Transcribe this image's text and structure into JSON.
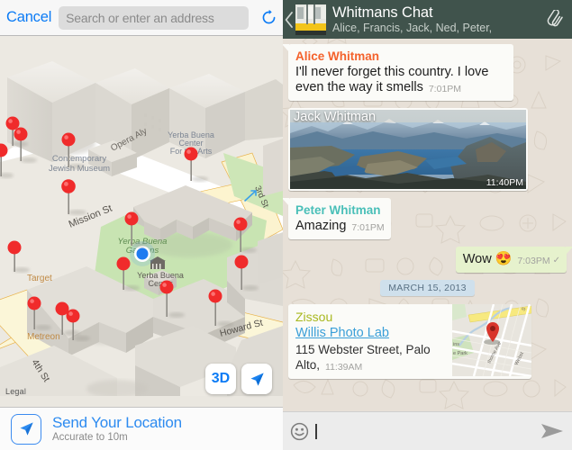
{
  "maps": {
    "cancel_label": "Cancel",
    "search_placeholder": "Search or enter an address",
    "refresh_icon": "refresh-icon",
    "button_3d_label": "3D",
    "locate_icon": "locate-arrow-icon",
    "legal_label": "Legal",
    "send_location_title": "Send Your Location",
    "send_location_subtitle": "Accurate to 10m",
    "send_location_icon": "navigation-arrow-icon",
    "labels": [
      "Contemporary Jewish Museum",
      "Yerba Buena Center For the Arts",
      "Yerba Buena Gardens",
      "Yerba Buena Center",
      "Mission St",
      "Opera Aly",
      "3rd St",
      "Howard St",
      "4th St",
      "Target",
      "Metreon"
    ],
    "pin_count": 16,
    "colors": {
      "pin": "#f02b2b",
      "accent": "#0b7bf5",
      "park": "#c4e3b0",
      "road": "#fdf6d3",
      "land": "#ece9e2"
    }
  },
  "chat": {
    "back_icon": "back-chevron-icon",
    "avatar_name": "group-avatar",
    "title": "Whitmans Chat",
    "subtitle": "Alice, Francis, Jack, Ned, Peter,",
    "attach_icon": "paperclip-icon",
    "messages": [
      {
        "type": "text",
        "direction": "in",
        "sender": "Alice Whitman",
        "sender_color": "#f4622c",
        "text": "I'll never forget this country. I love even the way it smells",
        "time": "7:01PM"
      },
      {
        "type": "image",
        "direction": "in",
        "sender": "Jack Whitman",
        "time": "11:40PM",
        "caption": "lake-and-mountains-photo"
      },
      {
        "type": "text",
        "direction": "in",
        "sender": "Peter Whitman",
        "sender_color": "#49bfb8",
        "text": "Amazing",
        "time": "7:01PM"
      },
      {
        "type": "text",
        "direction": "out",
        "sender": "",
        "text": "Wow",
        "emoji": "😍",
        "time": "7:03PM",
        "status_icon": "single-check-icon"
      },
      {
        "type": "date",
        "text": "MARCH 15, 2013"
      },
      {
        "type": "location",
        "direction": "in",
        "sender": "Zissou",
        "sender_color": "#a8b81f",
        "place_name": "Willis Photo Lab",
        "address": "115 Webster Street, Palo Alto,",
        "time": "11:39AM",
        "thumb_labels": [
          "ins",
          "e Park",
          "thorne Ave",
          "Webst"
        ]
      }
    ],
    "input": {
      "emoji_icon": "smiley-icon",
      "value": "",
      "send_icon": "send-arrow-icon"
    },
    "colors": {
      "header_bg": "#40534c",
      "wallpaper": "#e7e0d7",
      "bubble_in": "#fbfbf8",
      "bubble_out": "#e6f2cd",
      "date_chip": "#cfe0ec"
    }
  }
}
